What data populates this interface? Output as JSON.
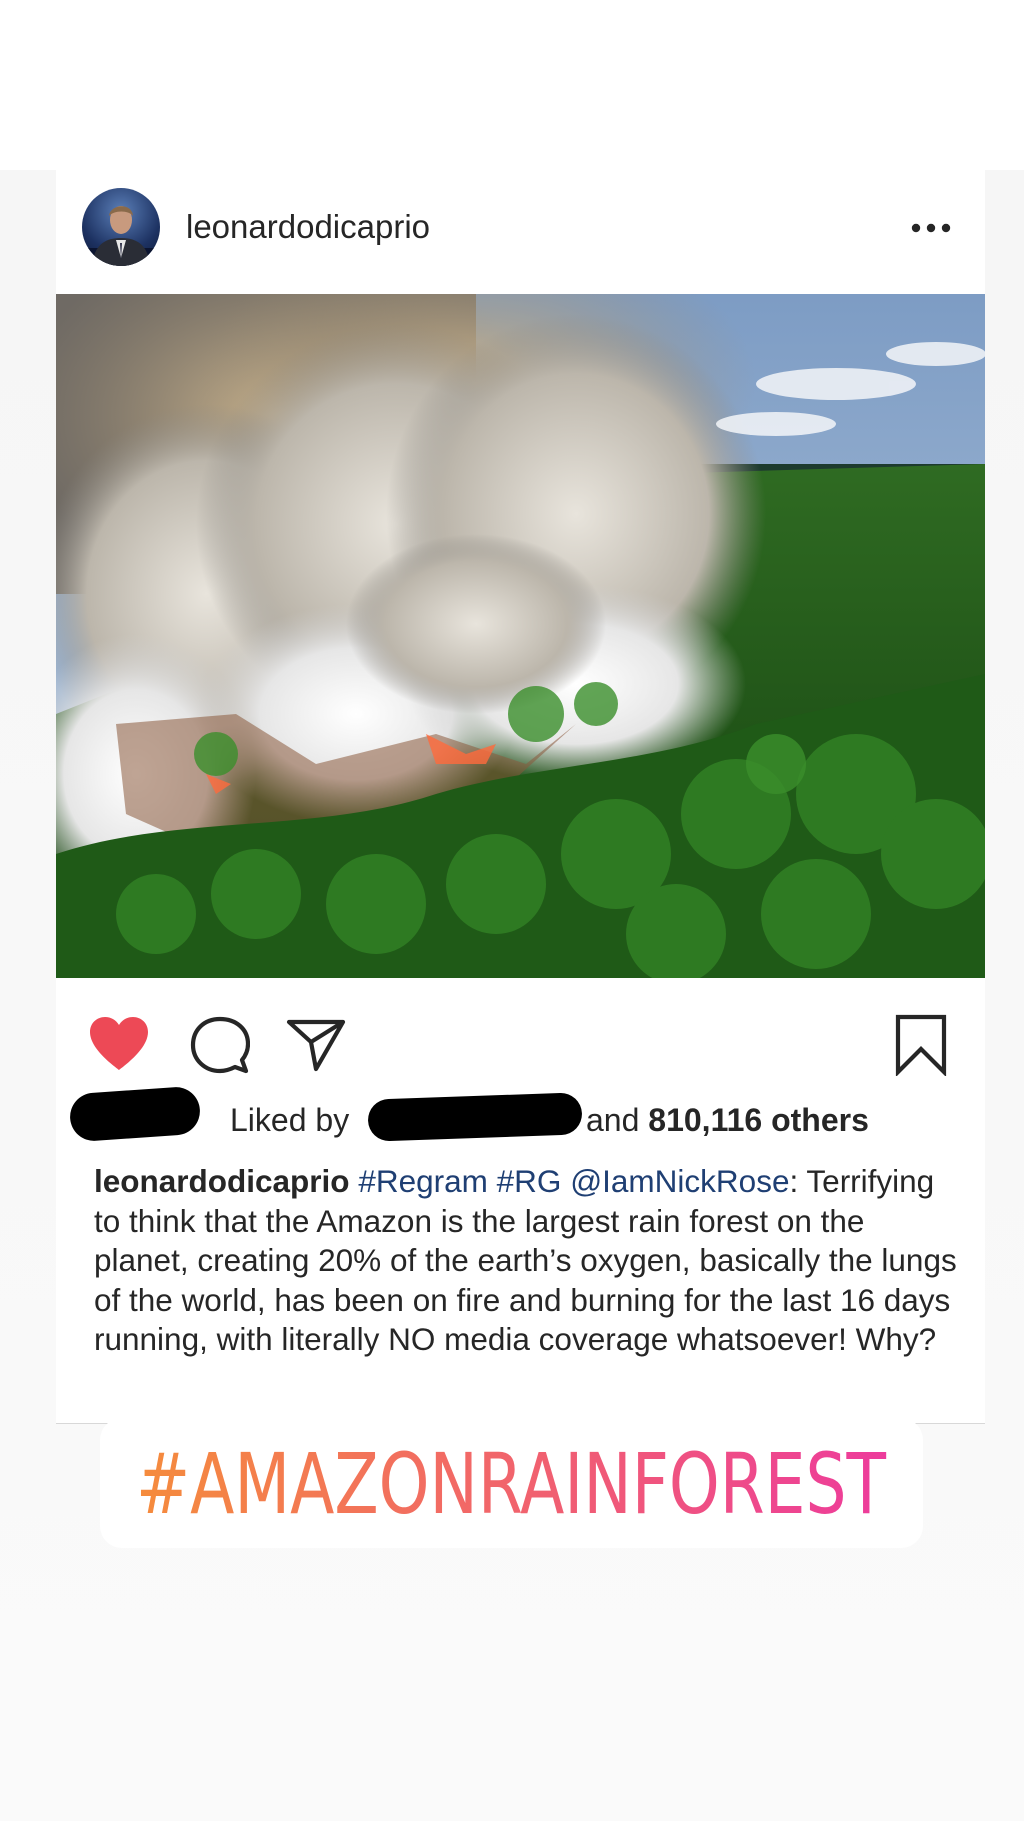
{
  "post": {
    "username": "leonardodicaprio",
    "image_description_icon": "photo-icon"
  },
  "likes": {
    "prefix": "Liked by",
    "and": "and",
    "count_text": "810,116 others"
  },
  "caption": {
    "username": "leonardodicaprio",
    "tags": [
      "#Regram",
      "#RG",
      "@IamNickRose"
    ],
    "colon": ":",
    "body": "Terrifying to think that the Amazon is the largest rain forest on the planet, creating 20% of the earth’s oxygen, basically the lungs of the world, has been on fire and burning for the last 16 days running, with literally NO media coverage whatsoever! Why?"
  },
  "sticker": {
    "text": "#AMAZONRAINFOREST",
    "gradient_start": "#f58c3c",
    "gradient_end": "#ed3b9c"
  },
  "colors": {
    "heart": "#ed4956",
    "hashtag": "#1f3f73",
    "text": "#262626"
  }
}
